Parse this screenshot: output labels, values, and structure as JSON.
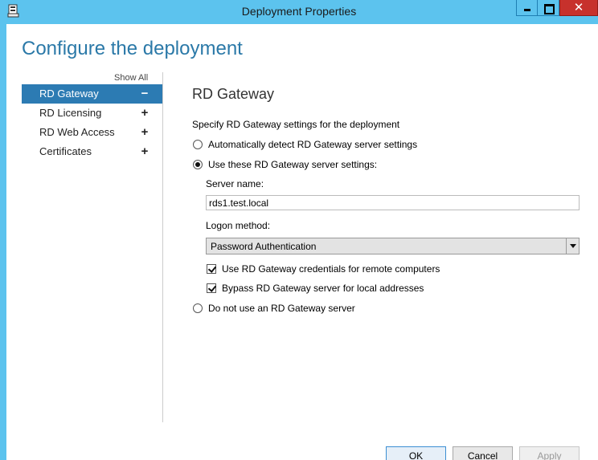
{
  "window": {
    "title": "Deployment Properties",
    "close_glyph": "✕"
  },
  "page": {
    "heading": "Configure the deployment"
  },
  "nav": {
    "show_all": "Show All",
    "items": [
      {
        "label": "RD Gateway",
        "sign": "−",
        "active": true
      },
      {
        "label": "RD Licensing",
        "sign": "+",
        "active": false
      },
      {
        "label": "RD Web Access",
        "sign": "+",
        "active": false
      },
      {
        "label": "Certificates",
        "sign": "+",
        "active": false
      }
    ]
  },
  "gateway": {
    "title": "RD Gateway",
    "description": "Specify RD Gateway settings for the deployment",
    "option_auto": "Automatically detect RD Gateway server settings",
    "option_use": "Use these RD Gateway server settings:",
    "option_none": "Do not use an RD Gateway server",
    "selected_option": "use",
    "server_name_label": "Server name:",
    "server_name_value": "rds1.test.local",
    "logon_method_label": "Logon method:",
    "logon_method_value": "Password Authentication",
    "use_credentials_label": "Use RD Gateway credentials for remote computers",
    "use_credentials_checked": true,
    "bypass_label": "Bypass RD Gateway server for local addresses",
    "bypass_checked": true
  },
  "buttons": {
    "ok": "OK",
    "cancel": "Cancel",
    "apply": "Apply"
  },
  "colors": {
    "accent": "#2c7bb3",
    "titlebar": "#5cc3ee",
    "close": "#c7312c",
    "heading": "#2b79a8"
  }
}
